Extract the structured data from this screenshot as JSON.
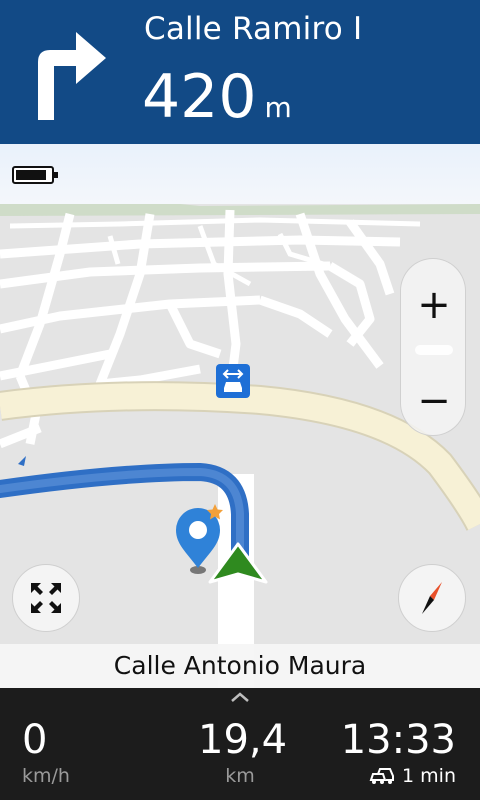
{
  "instruction": {
    "street": "Calle Ramiro I",
    "distance_value": "420",
    "distance_unit": "m",
    "turn_icon": "turn-right-arrow"
  },
  "map": {
    "current_street": "Calle Antonio Maura",
    "zoom_in_label": "+",
    "zoom_out_label": "−",
    "icons": {
      "battery": "battery-icon",
      "fullscreen": "fullscreen-icon",
      "compass": "compass-icon",
      "destination": "destination-pin-icon",
      "speed_camera": "speed-camera-icon",
      "vehicle": "vehicle-arrow-icon"
    },
    "colors": {
      "route": "#2f6fc5",
      "main_road": "#f7f1d6",
      "vehicle": "#2f8a1f",
      "pin": "#2f82d8",
      "camera_badge": "#1e6fd6"
    }
  },
  "trip": {
    "speed_value": "0",
    "speed_unit": "km/h",
    "distance_value": "19,4",
    "distance_unit": "km",
    "arrival_time": "13:33",
    "traffic_delay": "1 min"
  },
  "theme": {
    "header_bg": "#124a86",
    "footer_bg": "#1c1c1c"
  }
}
